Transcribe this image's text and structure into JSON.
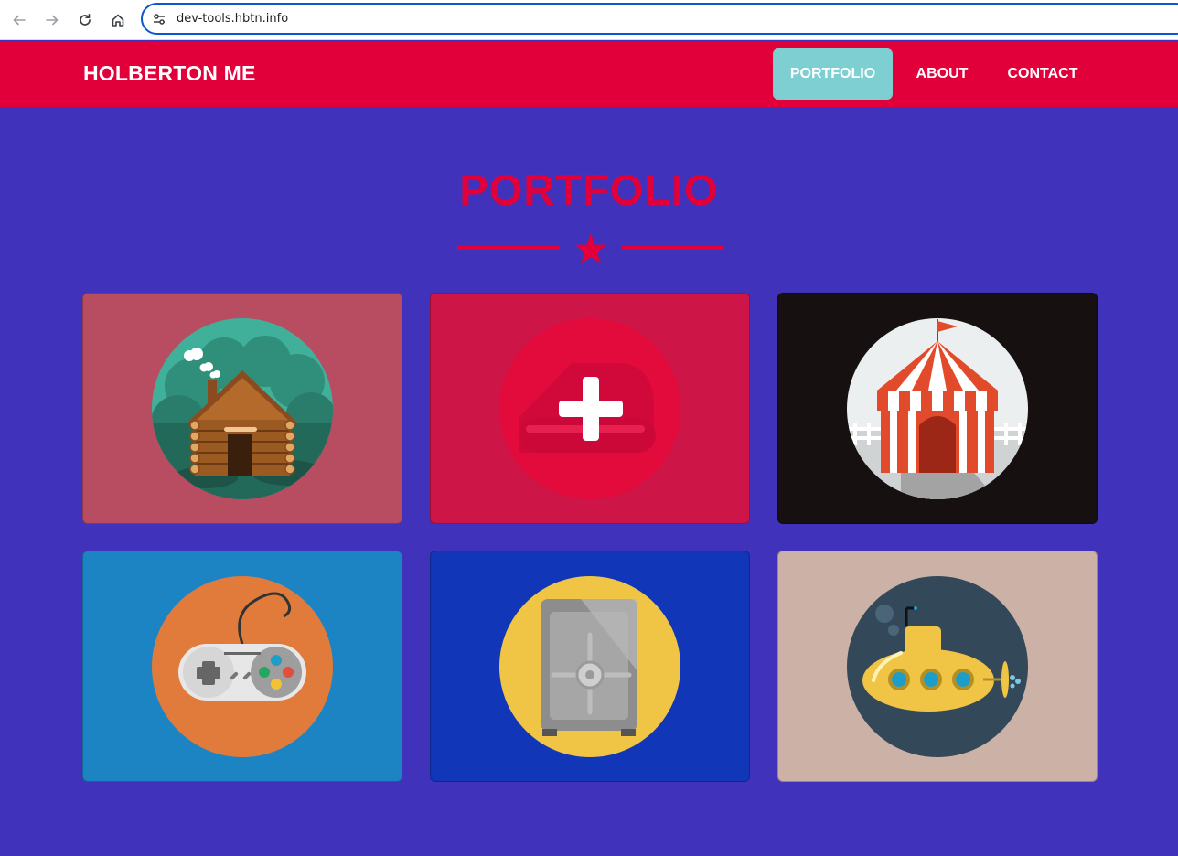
{
  "browser": {
    "url": "dev-tools.hbtn.info"
  },
  "header": {
    "logo": "HOLBERTON ME",
    "nav": [
      {
        "label": "PORTFOLIO",
        "active": true
      },
      {
        "label": "ABOUT",
        "active": false
      },
      {
        "label": "CONTACT",
        "active": false
      }
    ]
  },
  "portfolio": {
    "title": "PORTFOLIO",
    "items": [
      {
        "icon": "cabin-icon",
        "background": "#b84d62"
      },
      {
        "icon": "plus-icon",
        "background": "#cd1547"
      },
      {
        "icon": "circus-tent-icon",
        "background": "#161010"
      },
      {
        "icon": "game-controller-icon",
        "background": "#1d84c3"
      },
      {
        "icon": "safe-icon",
        "background": "#1137b8"
      },
      {
        "icon": "submarine-icon",
        "background": "#ccb2a6"
      }
    ]
  },
  "colors": {
    "page_background": "#4132bc",
    "accent": "#e1003a",
    "active_nav": "#7ecfd2"
  }
}
